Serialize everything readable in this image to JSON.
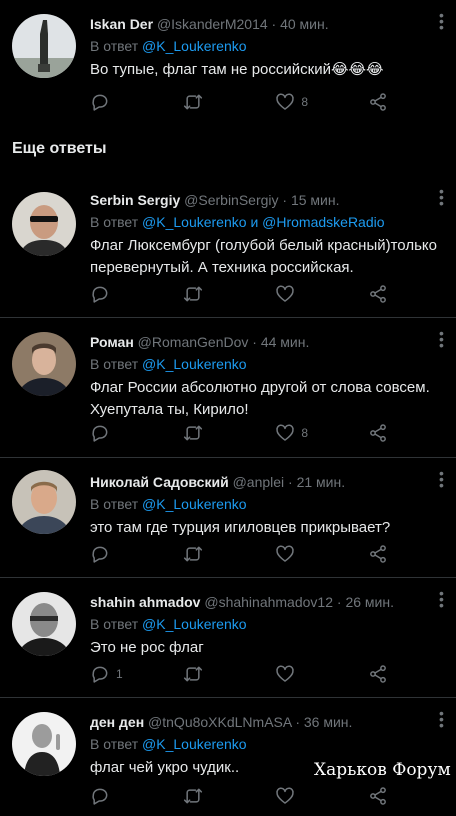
{
  "section_title": "Еще ответы",
  "watermark": "Харьков Форум",
  "reply_prefix": "В ответ",
  "tweets": [
    {
      "name": "Iskan Der",
      "handle": "@IskanderM2014",
      "time": "· 40 мин.",
      "reply_to": "@K_Loukerenko",
      "reply_to_2": "",
      "text": "Во тупые, флаг там не российский😂😂😂",
      "likes": "8",
      "retweets": "",
      "replies": ""
    },
    {
      "name": "Serbin Sergiy",
      "handle": "@SerbinSergiy",
      "time": "· 15 мин.",
      "reply_to": "@K_Loukerenko",
      "reply_conj": "и",
      "reply_to_2": "@HromadskeRadio",
      "text": "Флаг Люксембург (голубой белый красный)только перевернутый. А техника российская.",
      "likes": "",
      "retweets": "",
      "replies": ""
    },
    {
      "name": "Роман",
      "handle": "@RomanGenDov",
      "time": "· 44 мин.",
      "reply_to": "@K_Loukerenko",
      "reply_to_2": "",
      "text": "Флаг России абсолютно другой от слова совсем.\nХуепутала ты, Кирило!",
      "likes": "8",
      "retweets": "",
      "replies": ""
    },
    {
      "name": "Николай Садовский",
      "handle": "@anplei",
      "time": "· 21 мин.",
      "reply_to": "@K_Loukerenko",
      "reply_to_2": "",
      "text": "это там где турция игиловцев прикрывает?",
      "likes": "",
      "retweets": "",
      "replies": ""
    },
    {
      "name": "shahin ahmadov",
      "handle": "@shahinahmadov12",
      "time": "· 26 мин.",
      "reply_to": "@K_Loukerenko",
      "reply_to_2": "",
      "text": "Это не рос флаг",
      "likes": "",
      "retweets": "",
      "replies": "1"
    },
    {
      "name": "ден ден",
      "handle": "@tnQu8oXKdLNmASA",
      "time": "· 36 мин.",
      "reply_to": "@K_Loukerenko",
      "reply_to_2": "",
      "text": "флаг чей укро чудик..",
      "likes": "",
      "retweets": "",
      "replies": ""
    }
  ],
  "icons": {
    "reply": "reply-icon",
    "retweet": "retweet-icon",
    "like": "heart-icon",
    "share": "share-icon",
    "more": "more-icon"
  },
  "colors": {
    "background": "#000000",
    "text": "#e7e9ea",
    "muted": "#71767b",
    "link": "#1d9bf0",
    "divider": "#2f3336"
  }
}
